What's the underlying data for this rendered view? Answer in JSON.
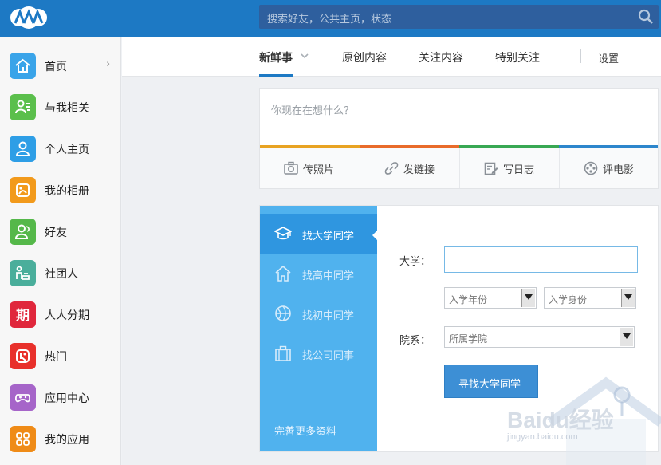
{
  "header": {
    "search_placeholder": "搜索好友，公共主页，状态"
  },
  "sidebar": {
    "items": [
      {
        "label": "首页",
        "color": "#3aa4e9",
        "icon": "home-icon"
      },
      {
        "label": "与我相关",
        "color": "#5bbf4c",
        "icon": "related-user-icon"
      },
      {
        "label": "个人主页",
        "color": "#2e9ee6",
        "icon": "profile-icon"
      },
      {
        "label": "我的相册",
        "color": "#f29a1c",
        "icon": "album-icon"
      },
      {
        "label": "好友",
        "color": "#55b84a",
        "icon": "friends-icon"
      },
      {
        "label": "社团人",
        "color": "#4aae9b",
        "icon": "club-icon"
      },
      {
        "label": "人人分期",
        "color": "#e0273c",
        "icon": "installment-icon"
      },
      {
        "label": "热门",
        "color": "#e8302b",
        "icon": "hot-icon"
      },
      {
        "label": "应用中心",
        "color": "#a665c9",
        "icon": "gamepad-icon"
      },
      {
        "label": "我的应用",
        "color": "#ef8b17",
        "icon": "apps-grid-icon"
      }
    ]
  },
  "tabs": {
    "items": [
      "新鲜事",
      "原创内容",
      "关注内容",
      "特别关注"
    ],
    "settings": "设置"
  },
  "composer": {
    "placeholder": "你现在在想什么？",
    "colors": [
      "#e8a322",
      "#e96b2a",
      "#38a853",
      "#2d86cc"
    ],
    "actions": [
      "传照片",
      "发链接",
      "写日志",
      "评电影"
    ]
  },
  "find": {
    "menu": [
      "找大学同学",
      "找高中同学",
      "找初中同学",
      "找公司同事"
    ],
    "complete_profile": "完善更多资料",
    "university_label": "大学：",
    "year_select": "入学年份",
    "identity_select": "入学身份",
    "department_label": "院系：",
    "department_select": "所属学院",
    "search_button": "寻找大学同学"
  },
  "watermark": {
    "brand": "Baidu经验",
    "url": "jingyan.baidu.com"
  }
}
